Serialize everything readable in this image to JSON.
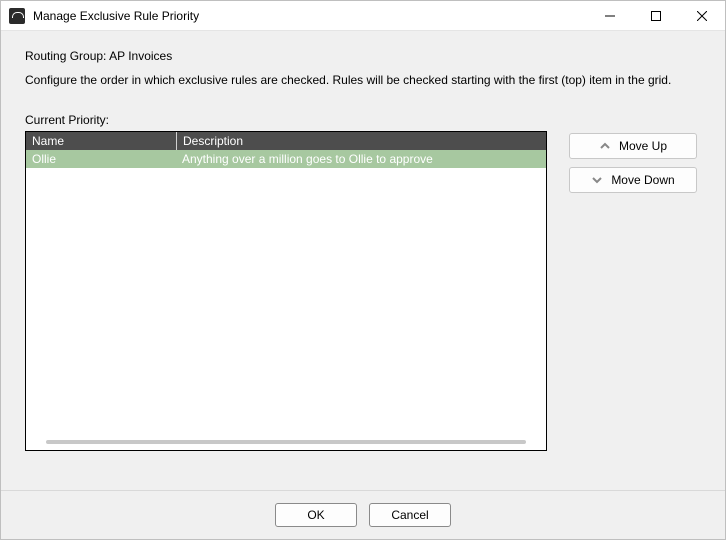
{
  "window": {
    "title": "Manage Exclusive Rule Priority"
  },
  "header": {
    "routing_prefix": "Routing Group:",
    "routing_value": "AP Invoices",
    "description": "Configure the order in which exclusive rules are checked. Rules will be checked starting with the first (top) item in the grid."
  },
  "grid": {
    "label": "Current Priority:",
    "columns": {
      "name": "Name",
      "description": "Description"
    },
    "rows": [
      {
        "name": "Ollie",
        "description": "Anything over a million goes to Ollie to approve",
        "selected": true
      }
    ]
  },
  "side": {
    "move_up": "Move Up",
    "move_down": "Move Down"
  },
  "footer": {
    "ok": "OK",
    "cancel": "Cancel"
  }
}
